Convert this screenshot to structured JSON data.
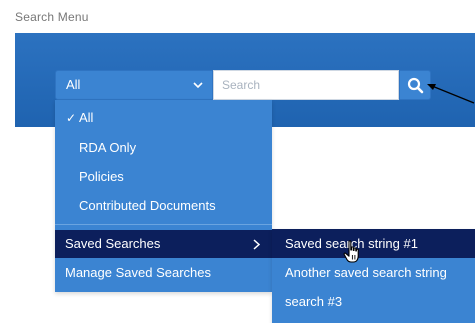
{
  "section_title": "Search Menu",
  "search": {
    "scope_selected": "All",
    "placeholder": "Search",
    "value": ""
  },
  "dropdown": {
    "items": [
      {
        "label": "All",
        "checked": true
      },
      {
        "label": "RDA Only"
      },
      {
        "label": "Policies"
      },
      {
        "label": "Contributed Documents"
      },
      {
        "label": "Saved Searches",
        "has_submenu": true,
        "active": true
      },
      {
        "label": "Manage Saved Searches"
      }
    ]
  },
  "submenu": {
    "items": [
      {
        "label": "Saved search string #1",
        "active": true
      },
      {
        "label": "Another saved search string"
      },
      {
        "label": "search #3"
      }
    ]
  },
  "colors": {
    "bar_blue": "#2c72c0",
    "menu_blue": "#3b84d2",
    "active_navy": "#0c1f5c"
  },
  "icons": [
    "chevron-down-icon",
    "search-icon",
    "check-icon",
    "chevron-right-icon",
    "arrow-pointer-icon",
    "hand-cursor-icon"
  ]
}
